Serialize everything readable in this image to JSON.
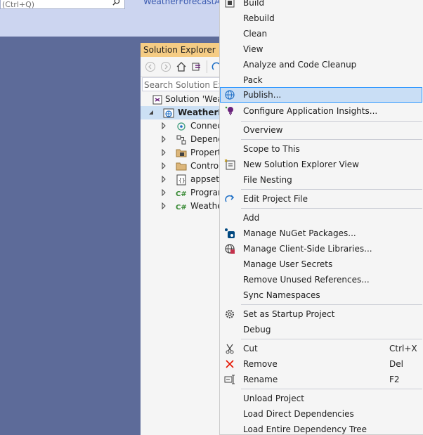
{
  "top": {
    "search_placeholder": "(Ctrl+Q)",
    "app_title": "WeatherForecastApp"
  },
  "solution_explorer": {
    "header": "Solution Explorer",
    "search_placeholder": "Search Solution Expl",
    "tree": [
      {
        "label": "Solution 'Weat",
        "icon": "solution-icon",
        "selected": false,
        "bold": false
      },
      {
        "label": "WeatherFo",
        "icon": "web-project-icon",
        "selected": true,
        "bold": true
      },
      {
        "label": "Connec",
        "icon": "connected-services-icon",
        "selected": false,
        "bold": false
      },
      {
        "label": "Depend",
        "icon": "dependencies-icon",
        "selected": false,
        "bold": false
      },
      {
        "label": "Propert",
        "icon": "properties-icon",
        "selected": false,
        "bold": false
      },
      {
        "label": "Control",
        "icon": "folder-icon",
        "selected": false,
        "bold": false
      },
      {
        "label": "appsett",
        "icon": "json-file-icon",
        "selected": false,
        "bold": false
      },
      {
        "label": "Program",
        "icon": "csharp-file-icon",
        "selected": false,
        "bold": false
      },
      {
        "label": "Weathe",
        "icon": "csharp-file-icon",
        "selected": false,
        "bold": false
      }
    ]
  },
  "context_menu": {
    "items": [
      {
        "label": "Build",
        "shortcut": ""
      },
      {
        "label": "Rebuild",
        "shortcut": ""
      },
      {
        "label": "Clean",
        "shortcut": ""
      },
      {
        "label": "View",
        "shortcut": ""
      },
      {
        "label": "Analyze and Code Cleanup",
        "shortcut": ""
      },
      {
        "label": "Pack",
        "shortcut": ""
      },
      {
        "label": "Publish...",
        "shortcut": ""
      },
      {
        "label": "Configure Application Insights...",
        "shortcut": ""
      },
      {
        "label": "Overview",
        "shortcut": ""
      },
      {
        "label": "Scope to This",
        "shortcut": ""
      },
      {
        "label": "New Solution Explorer View",
        "shortcut": ""
      },
      {
        "label": "File Nesting",
        "shortcut": ""
      },
      {
        "label": "Edit Project File",
        "shortcut": ""
      },
      {
        "label": "Add",
        "shortcut": ""
      },
      {
        "label": "Manage NuGet Packages...",
        "shortcut": ""
      },
      {
        "label": "Manage Client-Side Libraries...",
        "shortcut": ""
      },
      {
        "label": "Manage User Secrets",
        "shortcut": ""
      },
      {
        "label": "Remove Unused References...",
        "shortcut": ""
      },
      {
        "label": "Sync Namespaces",
        "shortcut": ""
      },
      {
        "label": "Set as Startup Project",
        "shortcut": ""
      },
      {
        "label": "Debug",
        "shortcut": ""
      },
      {
        "label": "Cut",
        "shortcut": "Ctrl+X"
      },
      {
        "label": "Remove",
        "shortcut": "Del"
      },
      {
        "label": "Rename",
        "shortcut": "F2"
      },
      {
        "label": "Unload Project",
        "shortcut": ""
      },
      {
        "label": "Load Direct Dependencies",
        "shortcut": ""
      },
      {
        "label": "Load Entire Dependency Tree",
        "shortcut": ""
      }
    ]
  },
  "colors": {
    "background": "#5d6b99",
    "menu_highlight": "#c9def5",
    "menu_highlight_border": "#3399ff",
    "panel_header": "#f5cc84"
  }
}
